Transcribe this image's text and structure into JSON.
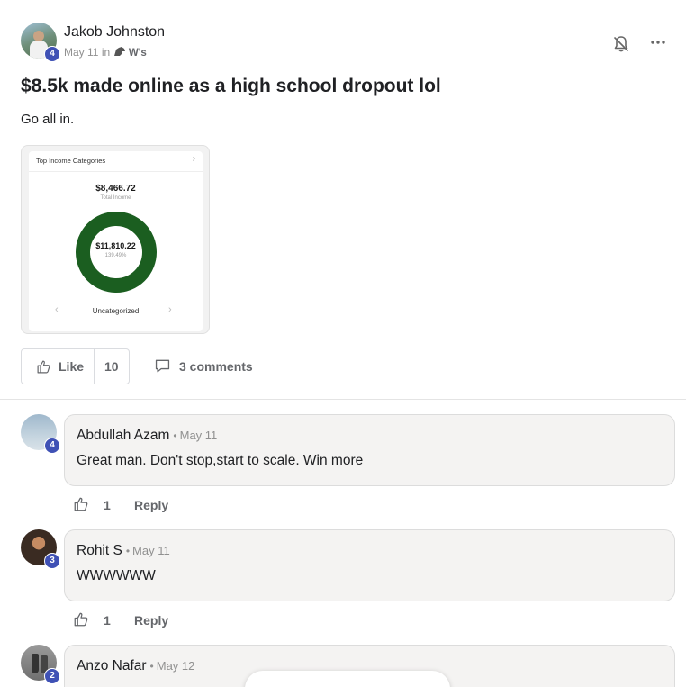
{
  "post": {
    "author": "Jakob Johnston",
    "author_level": "4",
    "date": "May 11",
    "in_label": "in",
    "group_name": "W's",
    "title": "$8.5k made online as a high school dropout lol",
    "body": "Go all in.",
    "like_label": "Like",
    "like_count": "10",
    "comments_label": "3 comments"
  },
  "attachment": {
    "card_title": "Top Income Categories",
    "total_income": "$8,466.72",
    "total_income_label": "Total Income",
    "donut_value": "$11,810.22",
    "donut_percent": "139.49%",
    "category": "Uncategorized",
    "donut_color": "#1b5e20"
  },
  "comments": [
    {
      "author": "Abdullah Azam",
      "date": "May 11",
      "level": "4",
      "text": "Great man. Don't stop,start to scale. Win more",
      "likes": "1",
      "reply_label": "Reply"
    },
    {
      "author": "Rohit S",
      "date": "May 11",
      "level": "3",
      "text": "WWWWWW",
      "likes": "1",
      "reply_label": "Reply"
    },
    {
      "author": "Anzo Nafar",
      "date": "May 12",
      "level": "2",
      "text": "",
      "likes": "",
      "reply_label": ""
    }
  ],
  "colors": {
    "level_badge": "#3f51b5",
    "muted_text": "#65676b",
    "bubble_bg": "#f4f3f2"
  },
  "icons": [
    "bell-off-icon",
    "more-horizontal-icon",
    "thumbs-up-icon",
    "comment-bubble-icon",
    "chevron-right-icon",
    "chevron-left-icon"
  ]
}
